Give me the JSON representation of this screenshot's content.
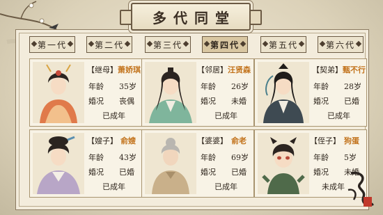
{
  "title": "多代同堂",
  "tabs": [
    "第一代",
    "第二代",
    "第三代",
    "第四代",
    "第五代",
    "第六代"
  ],
  "active_tab": "第四代",
  "labels": {
    "age": "年龄",
    "marital": "婚况"
  },
  "cards": [
    {
      "relation": "【继母】",
      "name": "萧娇琪",
      "age": "35岁",
      "marital": "丧偶",
      "status": "已成年"
    },
    {
      "relation": "【邻居】",
      "name": "汪贤森",
      "age": "26岁",
      "marital": "未婚",
      "status": "已成年"
    },
    {
      "relation": "【契弟】",
      "name": "甄不行",
      "age": "28岁",
      "marital": "已婚",
      "status": "已成年"
    },
    {
      "relation": "【嫂子】",
      "name": "俞嫂",
      "age": "43岁",
      "marital": "已婚",
      "status": "已成年"
    },
    {
      "relation": "【婆婆】",
      "name": "俞老",
      "age": "69岁",
      "marital": "已婚",
      "status": "已成年"
    },
    {
      "relation": "【侄子】",
      "name": "狗蛋",
      "age": "5岁",
      "marital": "未婚",
      "status": "未成年"
    }
  ],
  "colors": {
    "name": "#c2721a",
    "border": "#a8946f",
    "ink": "#2f261d"
  }
}
